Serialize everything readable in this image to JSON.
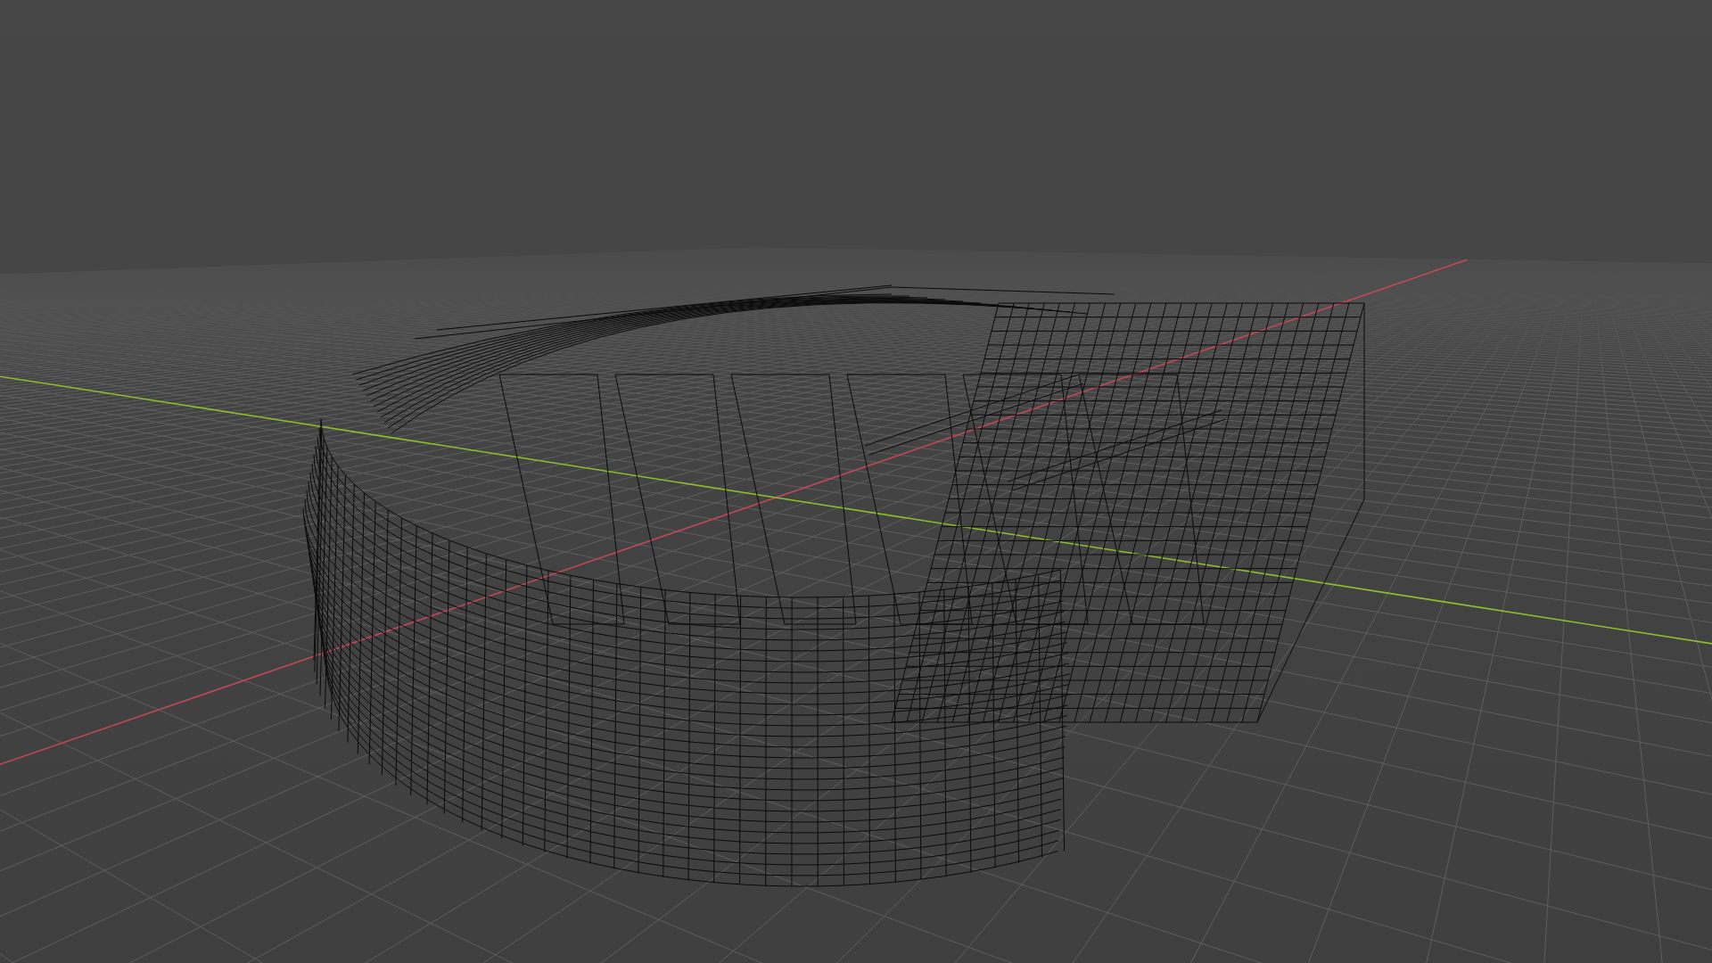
{
  "viewport": {
    "wireframe": true,
    "show_floor": true,
    "show_axes": true
  }
}
